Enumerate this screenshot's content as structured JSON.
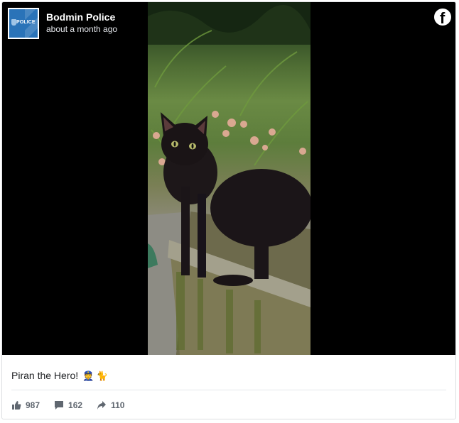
{
  "post": {
    "page_name": "Bodmin Police",
    "timestamp": "about a month ago",
    "avatar_text": "POLICE",
    "brand_icon": "facebook-icon",
    "caption": "Piran the Hero!",
    "caption_emojis": [
      "police-officer-emoji",
      "black-cat-emoji"
    ],
    "caption_emoji_chars": "👮 🐈"
  },
  "reactions": {
    "likes": "987",
    "comments": "162",
    "shares": "110"
  },
  "colors": {
    "media_background": "#000000",
    "avatar_blue": "#2a73b8",
    "stat_text": "#606770"
  }
}
